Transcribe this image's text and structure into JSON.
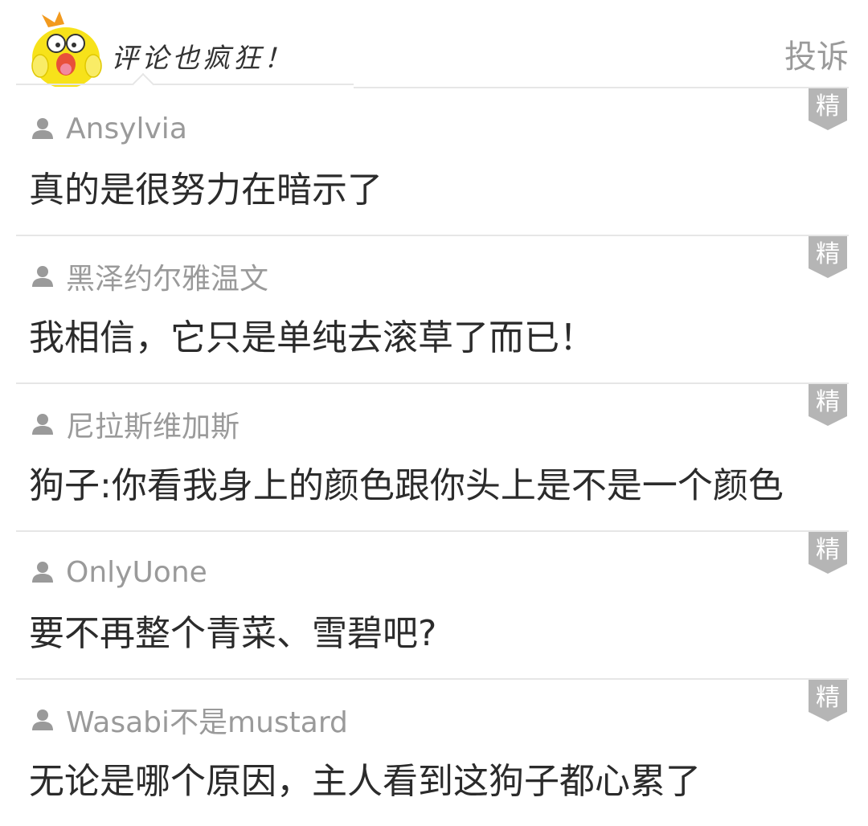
{
  "header": {
    "title": "评论也疯狂！",
    "report_label": "投诉",
    "mascot_icon": "yellow-chick-mascot-icon"
  },
  "colors": {
    "divider": "#e6e6e6",
    "username": "#9a9a9a",
    "text": "#2b2b2b",
    "badge": "#b5b5b5"
  },
  "comments": [
    {
      "username": "Ansylvia",
      "text": "真的是很努力在暗示了",
      "badge": "精"
    },
    {
      "username": "黑泽约尔雅温文",
      "text": "我相信，它只是单纯去滚草了而已！",
      "badge": "精"
    },
    {
      "username": "尼拉斯维加斯",
      "text": "狗子:你看我身上的颜色跟你头上是不是一个颜色",
      "badge": "精"
    },
    {
      "username": "OnlyUone",
      "text": "要不再整个青菜、雪碧吧?",
      "badge": "精"
    },
    {
      "username": "Wasabi不是mustard",
      "text": "无论是哪个原因，主人看到这狗子都心累了",
      "badge": "精"
    }
  ]
}
